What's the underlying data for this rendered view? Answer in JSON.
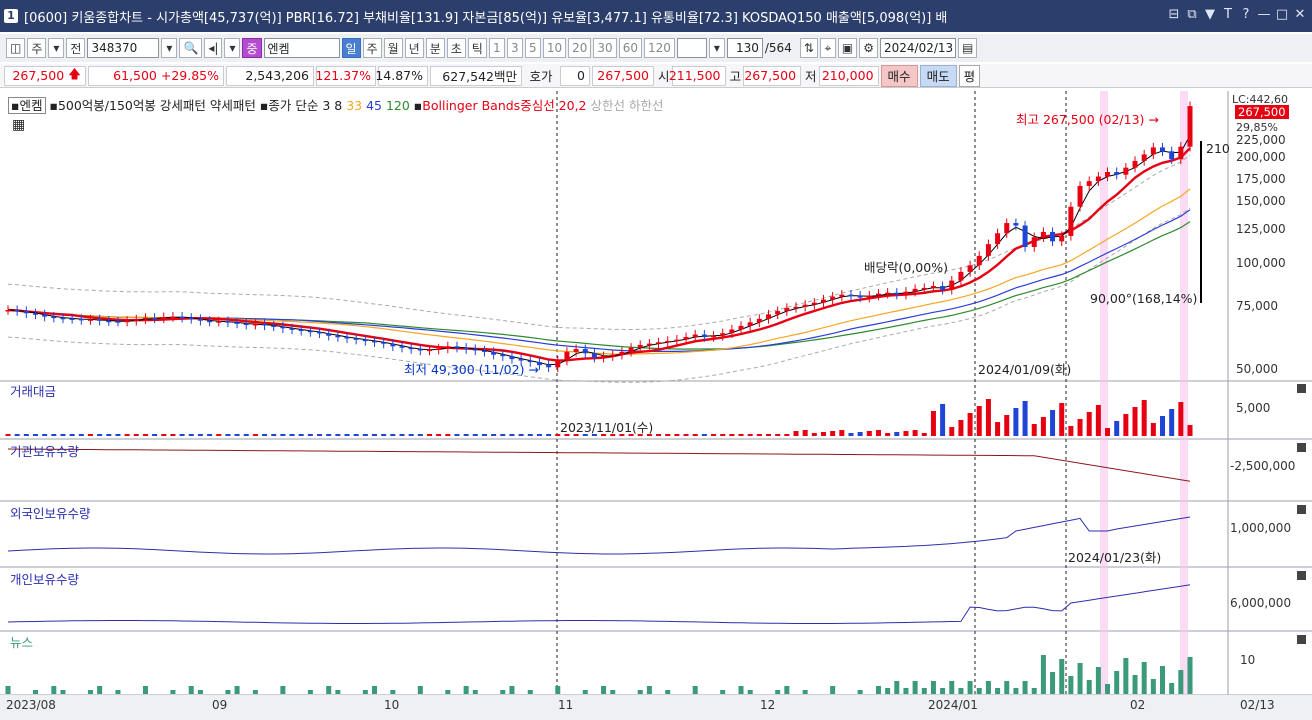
{
  "titlebar": {
    "window_no": "1",
    "title": "[0600] 키움종합차트 - 시가총액[45,737(억)] PBR[16.72] 부채비율[131.9] 자본금[85(억)] 유보율[3,477.1] 유통비율[72.3] KOSDAQ150 매출액[5,098(억)] 배",
    "buttons": [
      "⊟",
      "⧉",
      "▼",
      "T",
      "?",
      "—",
      "□",
      "✕"
    ]
  },
  "toolbar": {
    "period_select": "주",
    "all_label": "전",
    "code": "348370",
    "stock_badge": "중",
    "stock_name": "엔켐",
    "periods": [
      "일",
      "주",
      "월",
      "년",
      "분",
      "초",
      "틱"
    ],
    "minutes": [
      "1",
      "3",
      "5",
      "10",
      "20",
      "30",
      "60",
      "120"
    ],
    "count": "130",
    "total": "/564",
    "date": "2024/02/13"
  },
  "info": {
    "price": "267,500",
    "change": "61,500",
    "change_pct": "+29.85%",
    "volume": "2,543,206",
    "vol_ratio": "121.37%",
    "turnover": "14.87%",
    "amount": "627,542백만",
    "quote_label": "호가",
    "quote": "0",
    "quote_price": "267,500",
    "open_label": "시",
    "open": "211,500",
    "high_label": "고",
    "high": "267,500",
    "low_label": "저",
    "low": "210,000",
    "buy": "매수",
    "sell": "매도",
    "eq": "평"
  },
  "colors": {
    "up": "#e60012",
    "down": "#1f45d6",
    "ma3": "#000000",
    "ma8": "#e60012",
    "ma33": "#f5a623",
    "ma45": "#2b3fd6",
    "ma120": "#2e8b2e",
    "bb": "#aaaaaa",
    "volume_up": "#e60012",
    "volume_down": "#1f45d6",
    "inst": "#8b1a1a",
    "foreign": "#2b2fae",
    "retail": "#2b2fae",
    "news": "#3a9a7a",
    "highlight": "#f7c6ee"
  },
  "price_panel": {
    "legend": {
      "stock": "엔켐",
      "items": [
        "500억봉/150억봉",
        "강세패턴",
        "약세패턴",
        "종가 단순",
        "3",
        "8",
        "33",
        "45",
        "120",
        "Bollinger Bands중심선 20,2",
        "상한선",
        "하한선"
      ]
    },
    "annot_high": "최고 267,500 (02/13) →",
    "annot_low": "최저 49,300 (11/02) →",
    "annot_div": "배당락(0,00%)",
    "annot_rise": "90,00°(168,14%)",
    "annot_210": "210",
    "date_marker": "2024/01/09(화)",
    "lc": "LC:442,60",
    "last_price": "267,500",
    "last_pct": "29,85%",
    "y_ticks": [
      "225,000",
      "200,000",
      "175,000",
      "150,000",
      "125,000",
      "100,000",
      "75,000",
      "50,000"
    ]
  },
  "panels": {
    "volume": {
      "title": "거래대금",
      "tick": "5,000",
      "date": "2023/11/01(수)"
    },
    "inst": {
      "title": "기관보유수량",
      "tick": "-2,500,000"
    },
    "foreign": {
      "title": "외국인보유수량",
      "tick": "1,000,000",
      "date": "2024/01/23(화)"
    },
    "retail": {
      "title": "개인보유수량",
      "tick": "6,000,000"
    },
    "news": {
      "title": "뉴스",
      "tick": "10"
    }
  },
  "x_axis": [
    "2023/08",
    "09",
    "10",
    "11",
    "12",
    "2024/01",
    "02",
    "02/13"
  ],
  "chart_data": {
    "type": "candlestick",
    "candle_count": 130,
    "price_range": [
      48000,
      280000
    ],
    "log_scale": true,
    "first_candle_date": "2023/08",
    "last_candle_date": "2024/02/13",
    "closes": [
      72000,
      71500,
      70500,
      70000,
      69000,
      68500,
      68200,
      68000,
      67500,
      67800,
      67200,
      67000,
      66800,
      67200,
      67800,
      68500,
      68200,
      68800,
      69000,
      68500,
      68000,
      67200,
      66800,
      67000,
      66500,
      66000,
      65500,
      65800,
      65200,
      64800,
      64000,
      63500,
      63000,
      62500,
      62000,
      61000,
      60500,
      60000,
      59500,
      59000,
      58500,
      58000,
      57000,
      56500,
      56000,
      55500,
      55800,
      56200,
      57000,
      56500,
      56000,
      55500,
      55000,
      54000,
      53500,
      52500,
      52000,
      51500,
      50500,
      49800,
      52000,
      55000,
      56000,
      54500,
      53000,
      53500,
      54000,
      55000,
      56500,
      57500,
      58000,
      58500,
      59000,
      59500,
      60500,
      61500,
      60500,
      61000,
      62000,
      63500,
      65000,
      66500,
      68000,
      70000,
      71500,
      73000,
      73500,
      74500,
      75500,
      77000,
      78500,
      79500,
      79000,
      78000,
      79000,
      80000,
      80500,
      79500,
      81000,
      82500,
      83000,
      84000,
      82000,
      87000,
      92000,
      96000,
      102000,
      110000,
      118000,
      126000,
      124000,
      108000,
      115000,
      119000,
      112000,
      116000,
      140000,
      160000,
      165000,
      170000,
      175000,
      172000,
      180000,
      188000,
      196000,
      205000,
      200000,
      190000,
      206000,
      267500
    ],
    "events": [
      {
        "date": "2023/11/01",
        "label": "2023/11/01(수)"
      },
      {
        "date": "2024/01/09",
        "label": "2024/01/09(화)"
      },
      {
        "date": "2024/01/23",
        "label": "2024/01/23(화)"
      }
    ]
  }
}
